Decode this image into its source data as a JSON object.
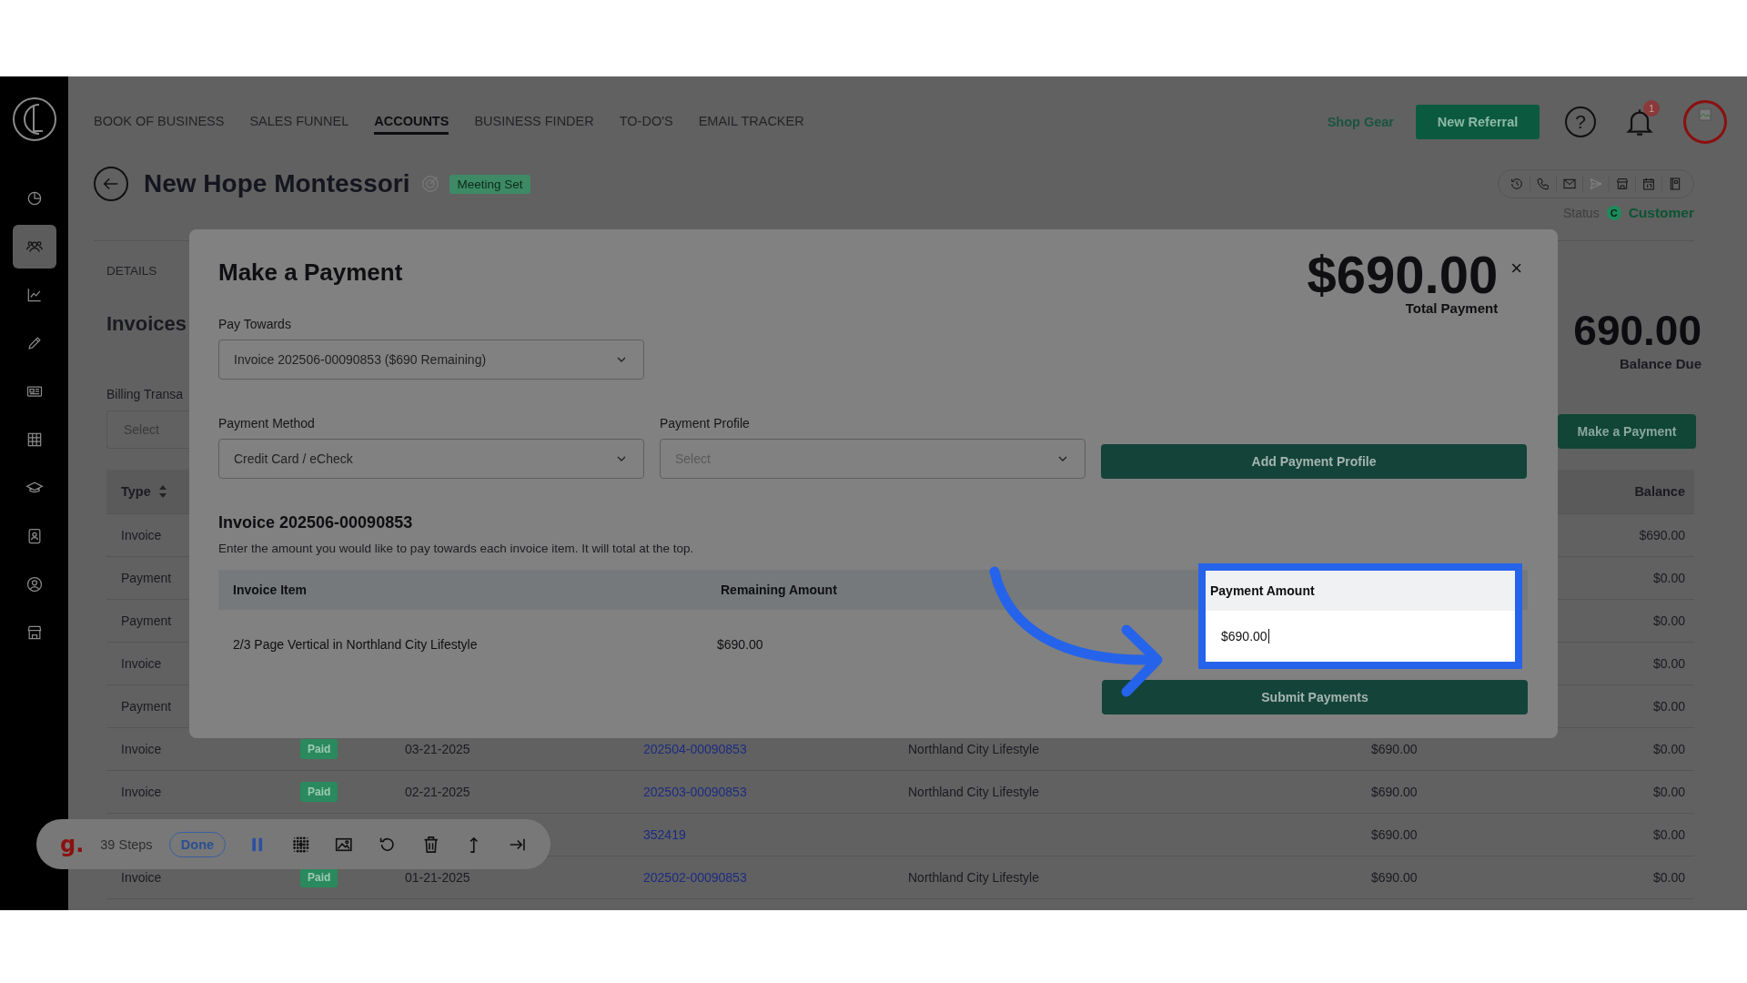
{
  "sidebar": {
    "items": [
      {
        "selected": false
      },
      {
        "selected": true
      },
      {
        "selected": false
      },
      {
        "selected": false
      },
      {
        "selected": false
      },
      {
        "selected": false
      },
      {
        "selected": false
      },
      {
        "selected": false
      },
      {
        "selected": false
      },
      {
        "selected": false
      }
    ]
  },
  "nav": {
    "items": [
      {
        "label": "BOOK OF BUSINESS",
        "selected": false
      },
      {
        "label": "SALES FUNNEL",
        "selected": false
      },
      {
        "label": "ACCOUNTS",
        "selected": true
      },
      {
        "label": "BUSINESS FINDER",
        "selected": false
      },
      {
        "label": "TO-DO'S",
        "selected": false
      },
      {
        "label": "EMAIL TRACKER",
        "selected": false
      }
    ],
    "shop_link": "Shop Gear",
    "referral_button": "New Referral",
    "help": "?",
    "notification_count": "1"
  },
  "account": {
    "name": "New Hope Montessori",
    "badge": "Meeting Set",
    "status_label": "Status",
    "status_icon": "C",
    "status": "Customer"
  },
  "contact_actions": [
    {
      "disabled": false
    },
    {
      "disabled": false
    },
    {
      "disabled": false
    },
    {
      "disabled": true
    },
    {
      "disabled": false
    },
    {
      "disabled": false
    },
    {
      "disabled": false
    }
  ],
  "tabs": [
    {
      "label": "DETAILS",
      "selected": false
    }
  ],
  "invoices": {
    "title": "Invoices",
    "balance": "690.00",
    "balance_label": "Balance Due",
    "filter_label": "Billing Transa",
    "filter_placeholder": "Select",
    "action_button": "Make a Payment",
    "type_column": "Type",
    "balance_column": "Balance",
    "rows": [
      {
        "type": "Invoice",
        "balance": "$690.00"
      },
      {
        "type": "Payment",
        "balance": "$0.00"
      },
      {
        "type": "Payment",
        "balance": "$0.00"
      },
      {
        "type": "Invoice",
        "balance": "$0.00"
      },
      {
        "type": "Payment",
        "balance": "$0.00"
      },
      {
        "type": "Invoice",
        "status": "Paid",
        "date": "03-21-2025",
        "invoice": "202504-00090853",
        "publication": "Northland City Lifestyle",
        "amount": "$690.00",
        "balance": "$0.00"
      },
      {
        "type": "Invoice",
        "status": "Paid",
        "date": "02-21-2025",
        "invoice": "202503-00090853",
        "publication": "Northland City Lifestyle",
        "amount": "$690.00",
        "balance": "$0.00"
      },
      {
        "invoice": "352419",
        "amount": "$690.00",
        "balance": "$0.00"
      },
      {
        "type": "Invoice",
        "status": "Paid",
        "date": "01-21-2025",
        "invoice": "202502-00090853",
        "publication": "Northland City Lifestyle",
        "amount": "$690.00",
        "balance": "$0.00"
      }
    ]
  },
  "modal": {
    "title": "Make a Payment",
    "total": "$690.00",
    "total_label": "Total Payment",
    "close": "×",
    "pay_towards_label": "Pay Towards",
    "pay_towards_value": "Invoice 202506-00090853 ($690 Remaining)",
    "method_label": "Payment Method",
    "method_value": "Credit Card / eCheck",
    "profile_label": "Payment Profile",
    "profile_placeholder": "Select",
    "add_profile_button": "Add Payment Profile",
    "invoice_title": "Invoice 202506-00090853",
    "instructions": "Enter the amount you would like to pay towards each invoice item. It will total at the top.",
    "columns": [
      "Invoice Item",
      "Remaining Amount",
      "Payment Amount"
    ],
    "items": [
      {
        "item": "2/3 Page Vertical in Northland City Lifestyle",
        "remaining": "$690.00",
        "payment": "$690.00"
      }
    ],
    "submit_button": "Submit Payments"
  },
  "recorder": {
    "logo": "g.",
    "steps": "39 Steps",
    "done_button": "Done"
  }
}
